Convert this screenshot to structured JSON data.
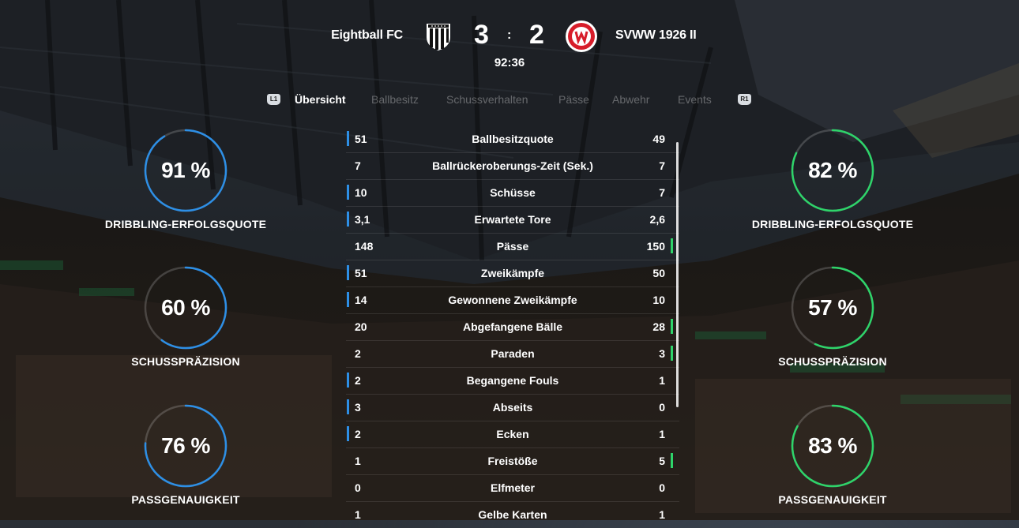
{
  "match": {
    "home_team": "Eightball FC",
    "away_team": "SVWW 1926 II",
    "home_score": "3",
    "separator": ":",
    "away_score": "2",
    "clock": "92:36"
  },
  "tabs": {
    "left_bumper": "L1",
    "right_bumper": "R1",
    "items": [
      {
        "label": "Übersicht",
        "active": true
      },
      {
        "label": "Ballbesitz",
        "active": false
      },
      {
        "label": "Schussverhalten",
        "active": false
      },
      {
        "label": "Pässe",
        "active": false
      },
      {
        "label": "Abwehr",
        "active": false
      },
      {
        "label": "Events",
        "active": false
      }
    ]
  },
  "colors": {
    "home_accent": "#2d8fe6",
    "away_accent": "#2ed46a",
    "ring_track": "rgba(255,255,255,0.18)"
  },
  "home_rings": [
    {
      "value": "91 %",
      "percent": 91,
      "label": "DRIBBLING-ERFOLGSQUOTE"
    },
    {
      "value": "60 %",
      "percent": 60,
      "label": "SCHUSSPRÄZISION"
    },
    {
      "value": "76 %",
      "percent": 76,
      "label": "PASSGENAUIGKEIT"
    }
  ],
  "away_rings": [
    {
      "value": "82 %",
      "percent": 82,
      "label": "DRIBBLING-ERFOLGSQUOTE"
    },
    {
      "value": "57 %",
      "percent": 57,
      "label": "SCHUSSPRÄZISION"
    },
    {
      "value": "83 %",
      "percent": 83,
      "label": "PASSGENAUIGKEIT"
    }
  ],
  "stats": [
    {
      "label": "Ballbesitzquote",
      "home": "51",
      "away": "49",
      "leader": "home"
    },
    {
      "label": "Ballrückeroberungs-Zeit (Sek.)",
      "home": "7",
      "away": "7",
      "leader": "none"
    },
    {
      "label": "Schüsse",
      "home": "10",
      "away": "7",
      "leader": "home"
    },
    {
      "label": "Erwartete Tore",
      "home": "3,1",
      "away": "2,6",
      "leader": "home"
    },
    {
      "label": "Pässe",
      "home": "148",
      "away": "150",
      "leader": "away"
    },
    {
      "label": "Zweikämpfe",
      "home": "51",
      "away": "50",
      "leader": "home"
    },
    {
      "label": "Gewonnene Zweikämpfe",
      "home": "14",
      "away": "10",
      "leader": "home"
    },
    {
      "label": "Abgefangene Bälle",
      "home": "20",
      "away": "28",
      "leader": "away"
    },
    {
      "label": "Paraden",
      "home": "2",
      "away": "3",
      "leader": "away"
    },
    {
      "label": "Begangene Fouls",
      "home": "2",
      "away": "1",
      "leader": "home"
    },
    {
      "label": "Abseits",
      "home": "3",
      "away": "0",
      "leader": "home"
    },
    {
      "label": "Ecken",
      "home": "2",
      "away": "1",
      "leader": "home"
    },
    {
      "label": "Freistöße",
      "home": "1",
      "away": "5",
      "leader": "away"
    },
    {
      "label": "Elfmeter",
      "home": "0",
      "away": "0",
      "leader": "none"
    },
    {
      "label": "Gelbe Karten",
      "home": "1",
      "away": "1",
      "leader": "none"
    }
  ]
}
